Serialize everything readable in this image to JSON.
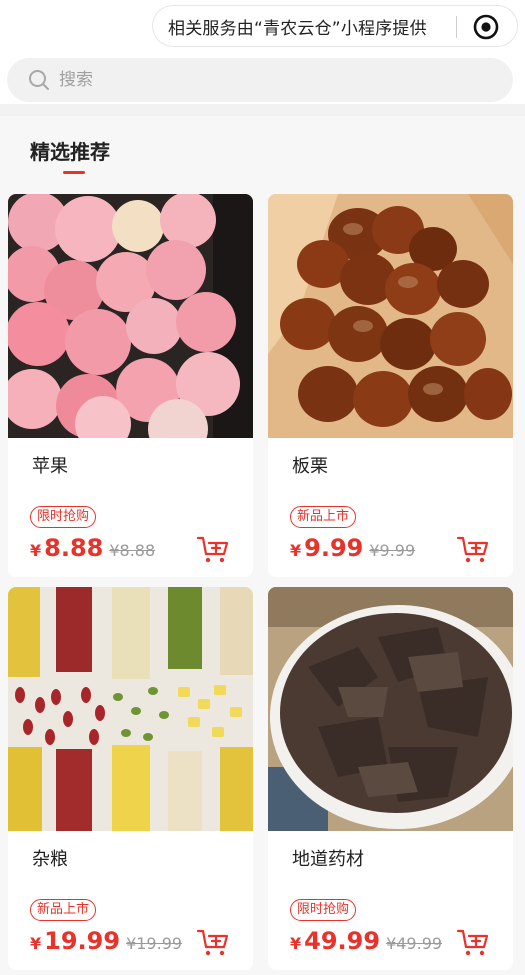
{
  "header": {
    "provider_text": "相关服务由“青农云仓”小程序提供",
    "provider_icon": "target-icon"
  },
  "search": {
    "placeholder": "搜索",
    "icon": "search-icon"
  },
  "section": {
    "title": "精选推荐",
    "accent_color": "#e8322a"
  },
  "products": [
    {
      "name": "苹果",
      "badge": "限时抢购",
      "currency": "¥",
      "price": "8.88",
      "original_price": "¥8.88",
      "image": "apples-photo"
    },
    {
      "name": "板栗",
      "badge": "新品上市",
      "currency": "¥",
      "price": "9.99",
      "original_price": "¥9.99",
      "image": "chestnuts-photo"
    },
    {
      "name": "杂粮",
      "badge": "新品上市",
      "currency": "¥",
      "price": "19.99",
      "original_price": "¥19.99",
      "image": "grains-photo"
    },
    {
      "name": "地道药材",
      "badge": "限时抢购",
      "currency": "¥",
      "price": "49.99",
      "original_price": "¥49.99",
      "image": "herbs-photo"
    }
  ],
  "colors": {
    "price_red": "#e8322a",
    "strike_gray": "#9a9a9a"
  }
}
